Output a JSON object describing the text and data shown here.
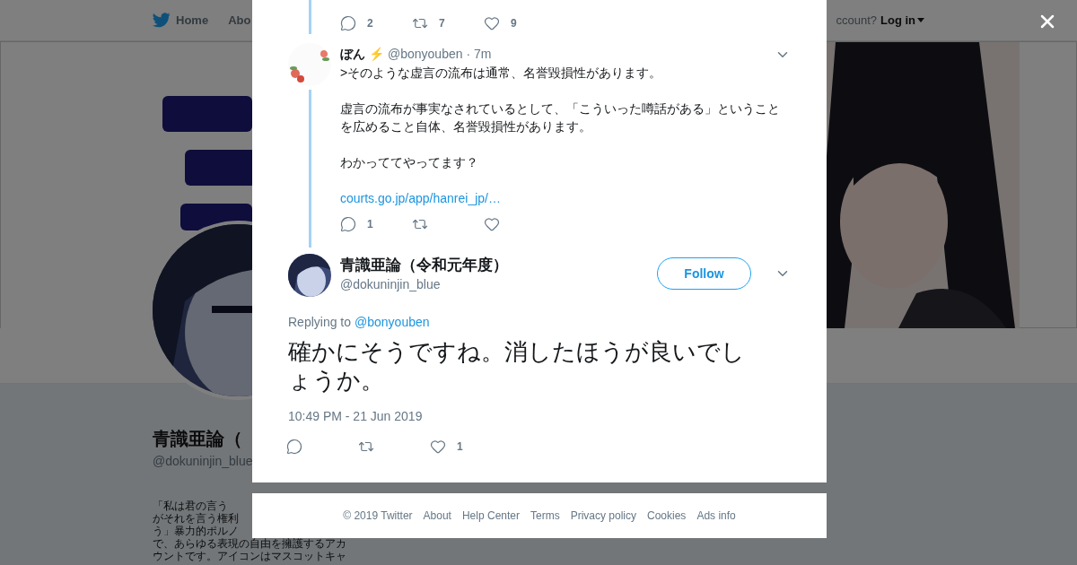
{
  "background": {
    "nav": {
      "items": [
        {
          "label": "Home",
          "kind": "home"
        },
        {
          "label": "Abo",
          "kind": "plain"
        }
      ],
      "account_prompt": "ccount?",
      "login": "Log in"
    },
    "profile": {
      "name": "青識亜論（",
      "handle": "@dokuninjin_blue",
      "bio_lines": [
        "「私は君の言う",
        "がそれを言う権利",
        "う」暴力的ポルノ",
        "で、あらゆる表現の自由を擁護するアカ",
        "ウントです。アイコンはマスコットキャ"
      ]
    }
  },
  "modal": {
    "thread_stats": {
      "replies": "2",
      "retweets": "7",
      "likes": "9"
    },
    "reply": {
      "name": "ぼん",
      "emoji": "⚡",
      "handle": "@bonyouben",
      "time": "· 7m",
      "paragraphs": [
        ">そのような虚言の流布は通常、名誉毀損性があります。",
        "虚言の流布が事実なされているとして、「こういった噂話がある」ということを広めること自体、名誉毀損性があります。",
        "わかっててやってます？"
      ],
      "link": "courts.go.jp/app/hanrei_jp/…",
      "stats": {
        "replies": "1"
      }
    },
    "main": {
      "name": "青識亜論（令和元年度）",
      "handle": "@dokuninjin_blue",
      "follow": "Follow",
      "replying_label": "Replying to",
      "replying_handle": "@bonyouben",
      "text": "確かにそうですね。消したほうが良いでしょうか。",
      "timestamp": "10:49 PM - 21 Jun 2019",
      "stats": {
        "likes": "1"
      }
    }
  },
  "footer": {
    "links": [
      "© 2019 Twitter",
      "About",
      "Help Center",
      "Terms",
      "Privacy policy",
      "Cookies",
      "Ads info"
    ]
  }
}
